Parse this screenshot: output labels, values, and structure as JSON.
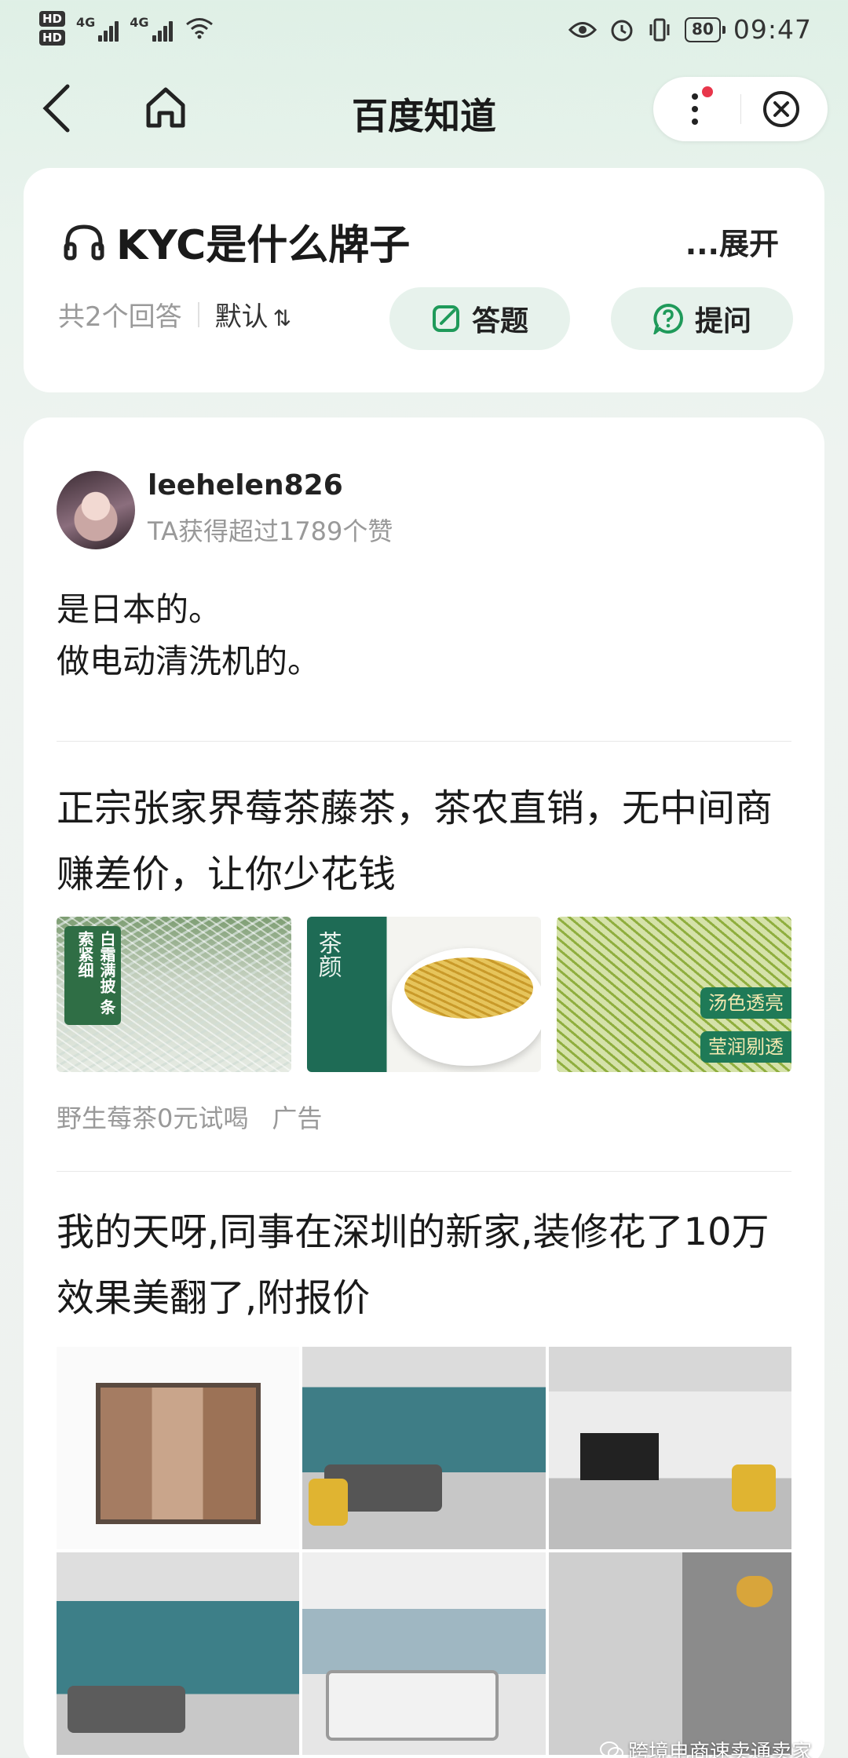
{
  "status_bar": {
    "hd1": "HD",
    "hd2": "HD",
    "signal1_label": "4G",
    "signal2_label": "4G",
    "battery": "80",
    "time": "09:47"
  },
  "nav": {
    "title": "百度知道"
  },
  "question": {
    "title": "KYC是什么牌子",
    "expand": "...展开",
    "answer_count": "共2个回答",
    "sort": "默认",
    "answer_button": "答题",
    "ask_button": "提问"
  },
  "answer": {
    "username": "leehelen826",
    "likes": "TA获得超过1789个赞",
    "lines": [
      "是日本的。",
      "做电动清洗机的。"
    ]
  },
  "ad1": {
    "title": "正宗张家界莓茶藤茶，茶农直销，无中间商赚差价，让你少花钱",
    "img1_text": "白霜满披 条索紧细",
    "img2_text": "茶颜",
    "img3_tag1": "汤色透亮",
    "img3_tag2": "莹润剔透",
    "source": "野生莓茶0元试喝",
    "ad_label": "广告"
  },
  "ad2": {
    "title": "我的天呀,同事在深圳的新家,装修花了10万效果美翻了,附报价"
  },
  "watermark": "跨境电商速卖通卖家",
  "colors": {
    "accent_green": "#1f9a5a",
    "notification_dot": "#e8364b",
    "pill_bg": "#e7f2ec"
  }
}
